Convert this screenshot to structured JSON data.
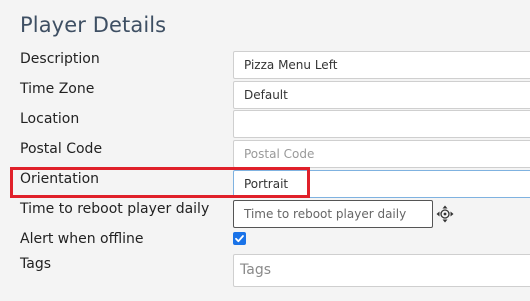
{
  "page": {
    "title": "Player Details"
  },
  "fields": {
    "description": {
      "label": "Description",
      "value": "Pizza Menu Left"
    },
    "time_zone": {
      "label": "Time Zone",
      "value": "Default"
    },
    "location": {
      "label": "Location",
      "value": ""
    },
    "postal_code": {
      "label": "Postal Code",
      "placeholder": "Postal Code"
    },
    "orientation": {
      "label": "Orientation",
      "value": "Portrait"
    },
    "reboot_time": {
      "label": "Time to reboot player daily",
      "placeholder": "Time to reboot player daily"
    },
    "alert_offline": {
      "label": "Alert when offline",
      "checked": true
    },
    "tags": {
      "label": "Tags",
      "placeholder": "Tags"
    }
  },
  "icons": {
    "move": "move-icon",
    "check": "checkmark-icon"
  },
  "colors": {
    "title": "#3e4f63",
    "highlight": "#e0202a",
    "checkbox": "#1a73e8"
  }
}
